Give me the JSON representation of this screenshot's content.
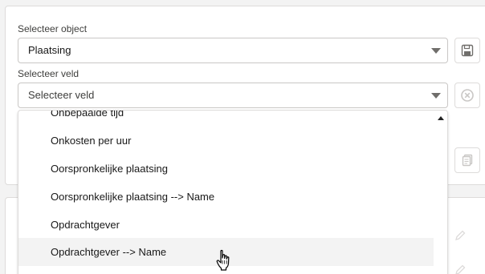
{
  "form": {
    "object_label": "Selecteer object",
    "object_value": "Plaatsing",
    "field_label": "Selecteer veld",
    "field_placeholder": "Selecteer veld"
  },
  "dropdown": {
    "items": [
      {
        "label": "Onbepaalde tijd"
      },
      {
        "label": "Onkosten per uur"
      },
      {
        "label": "Oorspronkelijke plaatsing"
      },
      {
        "label": "Oorspronkelijke plaatsing --> Name"
      },
      {
        "label": "Opdrachtgever"
      },
      {
        "label": "Opdrachtgever --> Name"
      }
    ],
    "hovered_index": 5
  },
  "icons": {
    "save": "save-icon",
    "clear": "clear-icon",
    "copy": "copy-icon",
    "edit": "pencil-icon",
    "cursor": "hand-pointer-icon"
  },
  "colors": {
    "border": "#c9c7c5",
    "icon_gray": "#706e6b",
    "hover_bg": "#f3f3f3"
  }
}
